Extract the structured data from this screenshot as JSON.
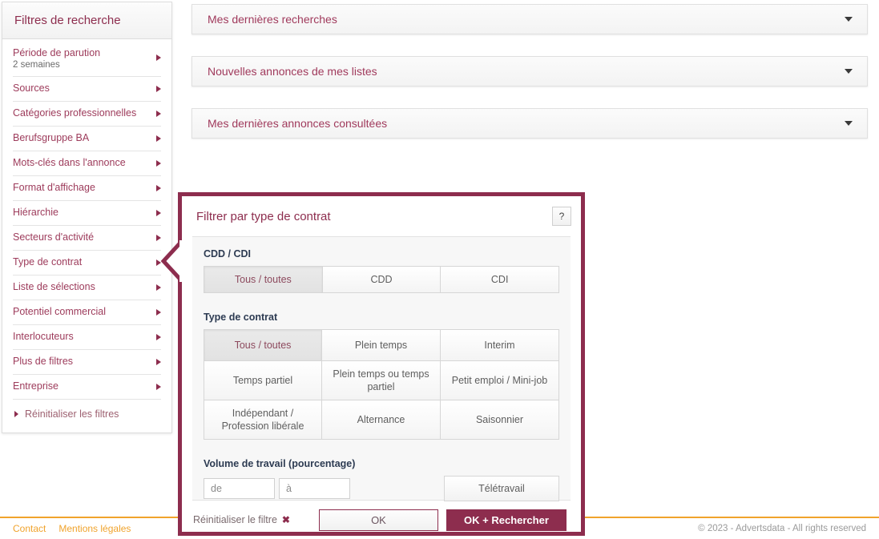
{
  "sidebar": {
    "header": "Filtres de recherche",
    "items": [
      {
        "label": "Période de parution",
        "sub": "2 semaines"
      },
      {
        "label": "Sources",
        "sub": ""
      },
      {
        "label": "Catégories professionnelles",
        "sub": ""
      },
      {
        "label": "Berufsgruppe BA",
        "sub": ""
      },
      {
        "label": "Mots-clés dans l'annonce",
        "sub": ""
      },
      {
        "label": "Format d'affichage",
        "sub": ""
      },
      {
        "label": "Hiérarchie",
        "sub": ""
      },
      {
        "label": "Secteurs d'activité",
        "sub": ""
      },
      {
        "label": "Type de contrat",
        "sub": ""
      },
      {
        "label": "Liste de sélections",
        "sub": ""
      },
      {
        "label": "Potentiel commercial",
        "sub": ""
      },
      {
        "label": "Interlocuteurs",
        "sub": ""
      },
      {
        "label": "Plus de filtres",
        "sub": ""
      },
      {
        "label": "Entreprise",
        "sub": ""
      }
    ],
    "reset_label": "Réinitialiser les filtres"
  },
  "accordions": [
    {
      "title": "Mes dernières recherches"
    },
    {
      "title": "Nouvelles annonces de mes listes"
    },
    {
      "title": "Mes dernières annonces consultées"
    }
  ],
  "modal": {
    "title": "Filtrer par type de contrat",
    "help_label": "?",
    "groups": [
      {
        "label": "CDD / CDI",
        "options": [
          {
            "label": "Tous / toutes",
            "selected": true
          },
          {
            "label": "CDD",
            "selected": false
          },
          {
            "label": "CDI",
            "selected": false
          }
        ]
      },
      {
        "label": "Type de contrat",
        "options": [
          {
            "label": "Tous / toutes",
            "selected": true
          },
          {
            "label": "Plein temps",
            "selected": false
          },
          {
            "label": "Interim",
            "selected": false
          },
          {
            "label": "Temps partiel",
            "selected": false
          },
          {
            "label": "Plein temps ou temps partiel",
            "selected": false
          },
          {
            "label": "Petit emploi / Mini-job",
            "selected": false
          },
          {
            "label": "Indépendant / Profession libérale",
            "selected": false
          },
          {
            "label": "Alternance",
            "selected": false
          },
          {
            "label": "Saisonnier",
            "selected": false
          }
        ]
      }
    ],
    "volume": {
      "label": "Volume de travail (pourcentage)",
      "from_placeholder": "de",
      "from_value": "",
      "to_placeholder": "à",
      "to_value": "",
      "teletravail_label": "Télétravail"
    },
    "footer": {
      "reset_label": "Réinitialiser le filtre",
      "reset_icon": "✖",
      "ok_label": "OK",
      "ok_search_label": "OK + Rechercher"
    }
  },
  "footer": {
    "links": [
      "Contact",
      "Mentions légales"
    ],
    "copyright": "© 2023 - Advertsdata - All rights reserved"
  },
  "colors": {
    "accent": "#8d2d4e",
    "link": "#9d3b5b",
    "footer_accent": "#f0a32c",
    "group_label": "#2d3b52"
  }
}
